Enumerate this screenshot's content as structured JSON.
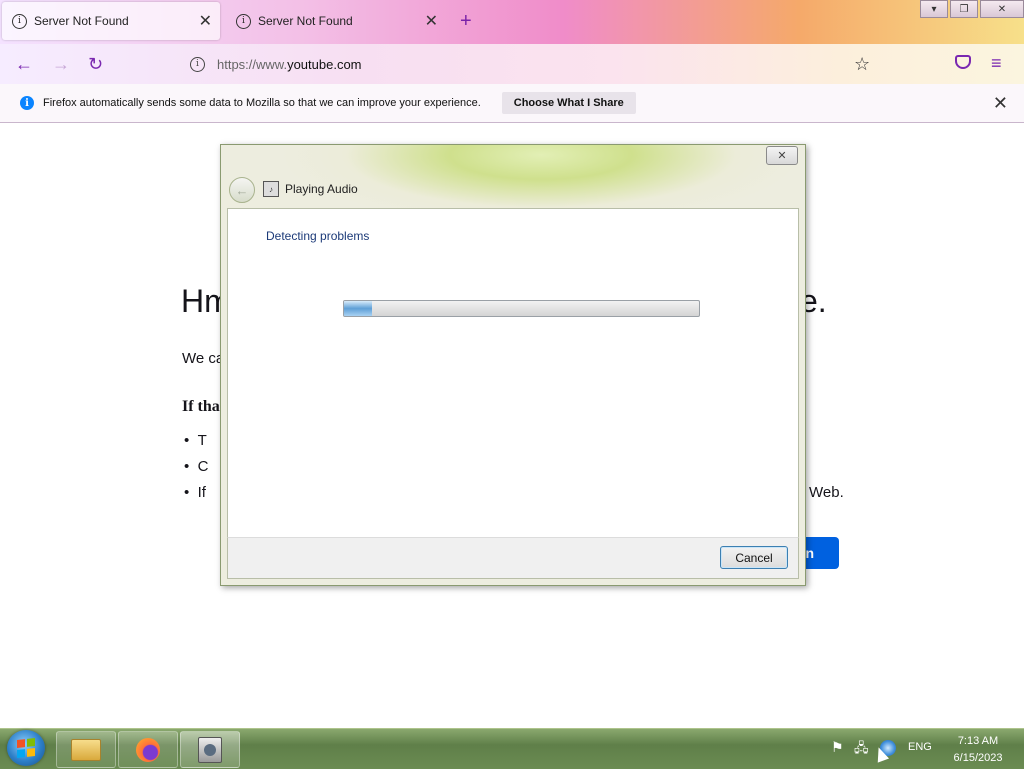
{
  "browser": {
    "tabs": [
      {
        "title": "Server Not Found",
        "active": true
      },
      {
        "title": "Server Not Found",
        "active": false
      }
    ],
    "url_prefix": "https://www.",
    "url_host": "youtube.com",
    "notification": {
      "text": "Firefox automatically sends some data to Mozilla so that we can improve your experience.",
      "button": "Choose What I Share"
    }
  },
  "page": {
    "title_start": "Hm",
    "title_end": "e.",
    "line1": "We ca",
    "line2": "If tha",
    "bullets": [
      "T",
      "C",
      "If"
    ],
    "bullet3_tail": "Web.",
    "button_tail": "n"
  },
  "dialog": {
    "title": "Playing Audio",
    "status": "Detecting problems",
    "progress": 0.08,
    "cancel": "Cancel"
  },
  "taskbar": {
    "language": "ENG",
    "time": "7:13 AM",
    "date": "6/15/2023"
  }
}
